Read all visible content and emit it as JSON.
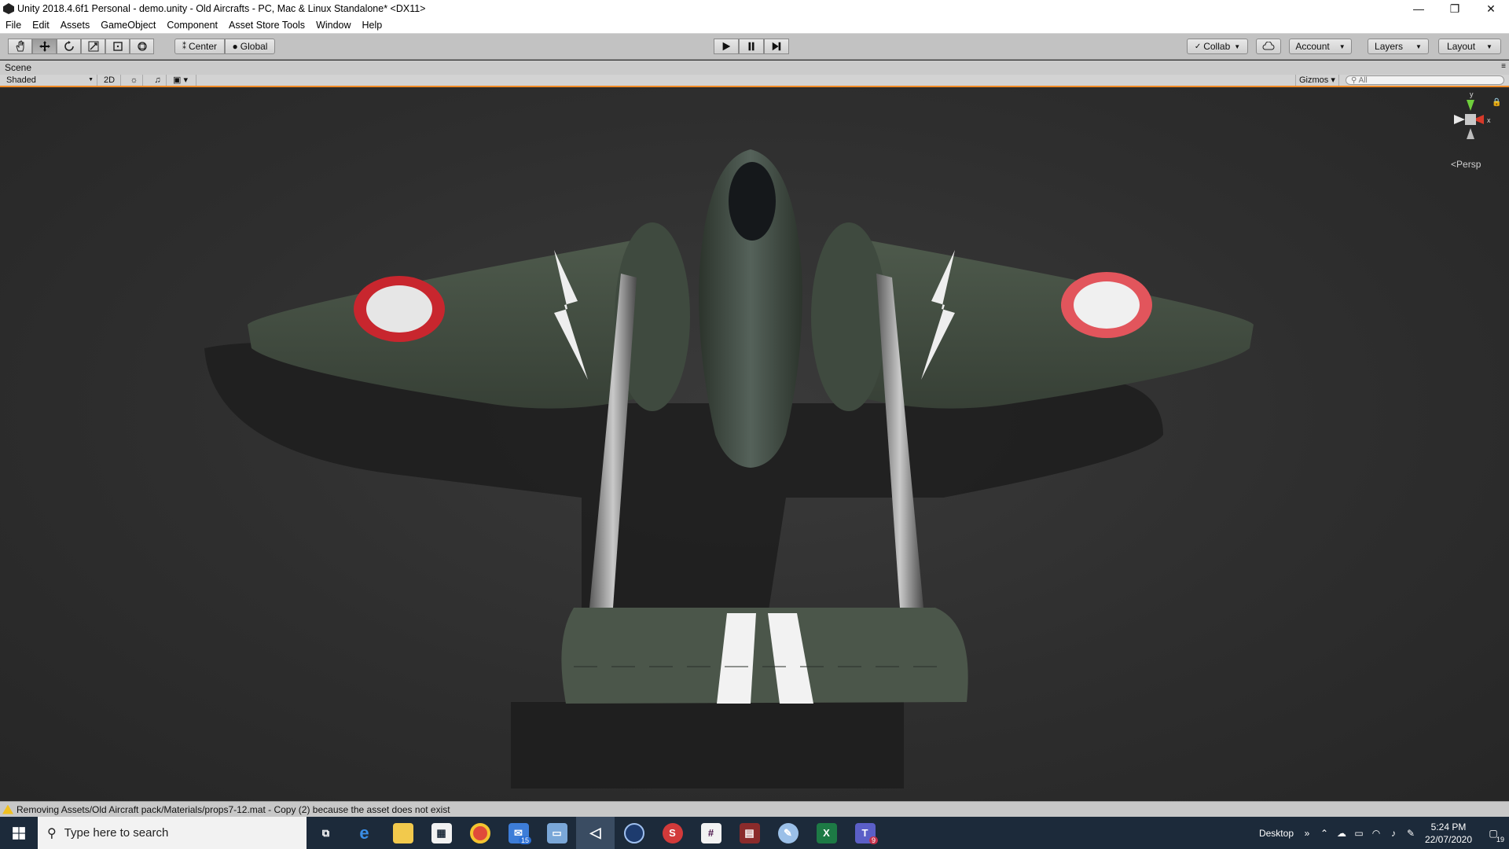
{
  "window": {
    "title": "Unity 2018.4.6f1 Personal - demo.unity - Old Aircrafts - PC, Mac & Linux Standalone* <DX11>",
    "minimize_glyph": "—",
    "restore_glyph": "❐",
    "close_glyph": "✕"
  },
  "menu": [
    "File",
    "Edit",
    "Assets",
    "GameObject",
    "Component",
    "Asset Store Tools",
    "Window",
    "Help"
  ],
  "toolbar": {
    "pivot_label": "Center",
    "space_label": "Global",
    "collab_label": "Collab",
    "account_label": "Account",
    "layers_label": "Layers",
    "layout_label": "Layout"
  },
  "scene": {
    "tab_label": "Scene",
    "shading_mode": "Shaded",
    "mode_2d": "2D",
    "gizmos_label": "Gizmos",
    "search_placeholder": "All",
    "persp_label": "Persp",
    "axis_y": "y",
    "axis_x": "x"
  },
  "status": {
    "message": "Removing Assets/Old Aircraft pack/Materials/props7-12.mat - Copy (2) because the asset does not exist"
  },
  "taskbar": {
    "search_placeholder": "Type here to search",
    "mail_badge": "15",
    "teams_badge": "9",
    "desktop_label": "Desktop",
    "time": "5:24 PM",
    "date": "22/07/2020",
    "notification_count": "19"
  },
  "colors": {
    "accent_orange": "#f08a24",
    "aircraft_green": "#3e4a3e",
    "roundel_red": "#c8262e"
  }
}
